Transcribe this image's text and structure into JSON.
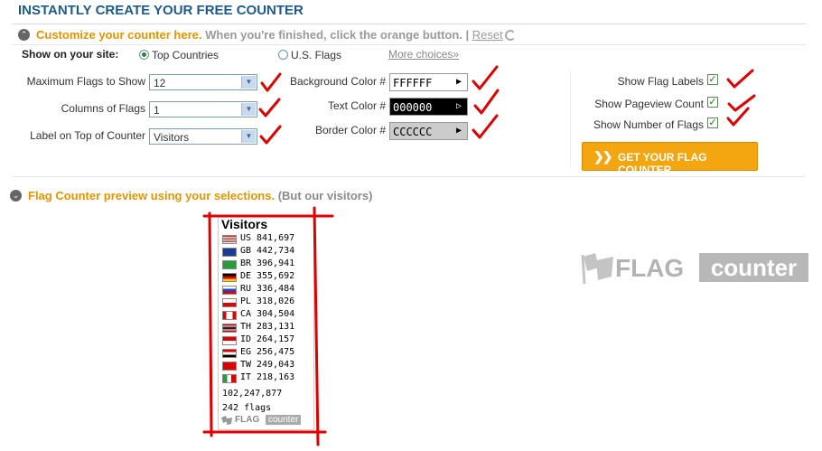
{
  "header": {
    "title": "INSTANTLY CREATE YOUR FREE COUNTER"
  },
  "instructions": {
    "main": "Customize your counter here.",
    "secondary": "When you're finished, click the orange button.",
    "reset_label": "Reset"
  },
  "show_on_site": {
    "label": "Show on your site:",
    "options": [
      "Top Countries",
      "U.S. Flags"
    ],
    "more_choices": "More choices»"
  },
  "fields": {
    "max_flags_label": "Maximum Flags to Show",
    "max_flags_value": "12",
    "columns_label": "Columns of Flags",
    "columns_value": "1",
    "label_top_label": "Label on Top of Counter",
    "label_top_value": "Visitors",
    "bg_color_label": "Background Color #",
    "bg_color_value": "FFFFFF",
    "text_color_label": "Text Color #",
    "text_color_value": "000000",
    "border_color_label": "Border Color #",
    "border_color_value": "CCCCCC"
  },
  "toggles": {
    "show_flag_labels": "Show Flag Labels",
    "show_pageview_count": "Show Pageview Count",
    "show_number_of_flags": "Show Number of Flags"
  },
  "get_button": {
    "label": "GET YOUR FLAG COUNTER"
  },
  "preview": {
    "title": "Flag Counter preview using your selections.",
    "subtitle": "(But our visitors)"
  },
  "counter": {
    "title": "Visitors",
    "rows": [
      {
        "code": "US",
        "count": "841,697"
      },
      {
        "code": "GB",
        "count": "442,734"
      },
      {
        "code": "BR",
        "count": "396,941"
      },
      {
        "code": "DE",
        "count": "355,692"
      },
      {
        "code": "RU",
        "count": "336,484"
      },
      {
        "code": "PL",
        "count": "318,026"
      },
      {
        "code": "CA",
        "count": "304,504"
      },
      {
        "code": "TH",
        "count": "283,131"
      },
      {
        "code": "ID",
        "count": "264,157"
      },
      {
        "code": "EG",
        "count": "256,475"
      },
      {
        "code": "TW",
        "count": "249,043"
      },
      {
        "code": "IT",
        "count": "218,163"
      }
    ],
    "pageviews": "102,247,877",
    "flags": "242 flags",
    "logo_flag": "FLAG",
    "logo_counter": "counter"
  },
  "logo": {
    "flag": "FLAG",
    "counter": "counter"
  },
  "colors": {
    "title_blue": "#1d5b8d",
    "accent_orange": "#e49400",
    "button_orange": "#f4a610",
    "annotation_red": "#e00000"
  }
}
